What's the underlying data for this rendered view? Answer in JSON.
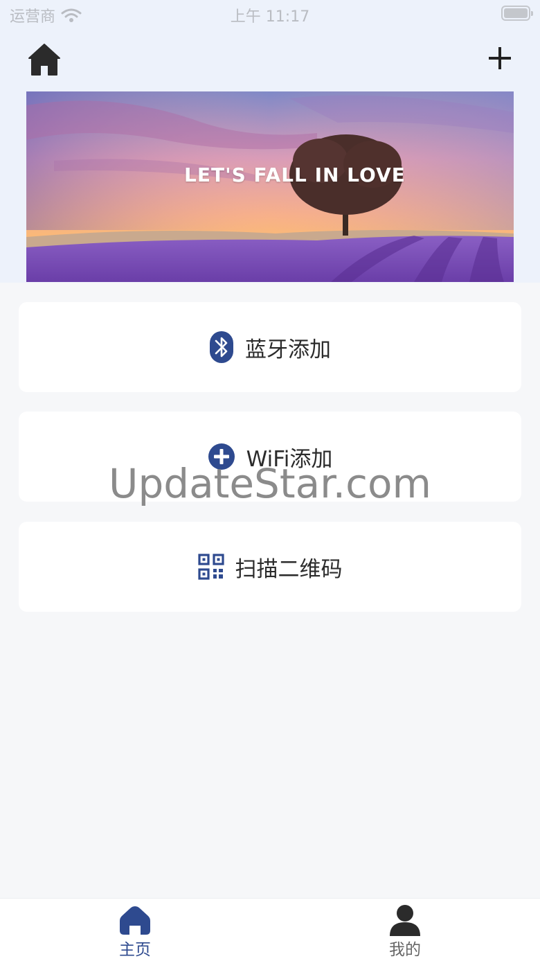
{
  "status_bar": {
    "carrier": "运营商",
    "time": "上午 11:17"
  },
  "nav": {
    "home_icon": "home-icon",
    "add_icon": "plus-icon"
  },
  "banner": {
    "title": "LET'S FALL IN LOVE"
  },
  "cards": [
    {
      "label": "蓝牙添加",
      "icon": "bluetooth-icon"
    },
    {
      "label": "WiFi添加",
      "icon": "plus-circle-icon"
    },
    {
      "label": "扫描二维码",
      "icon": "qr-code-icon"
    }
  ],
  "watermark": "UpdateStar.com",
  "tabs": [
    {
      "label": "主页",
      "icon": "home-icon",
      "active": true
    },
    {
      "label": "我的",
      "icon": "user-icon",
      "active": false
    }
  ],
  "colors": {
    "accent": "#2e4a8f",
    "header_bg": "#edf2fb",
    "page_bg": "#f6f7f9"
  }
}
